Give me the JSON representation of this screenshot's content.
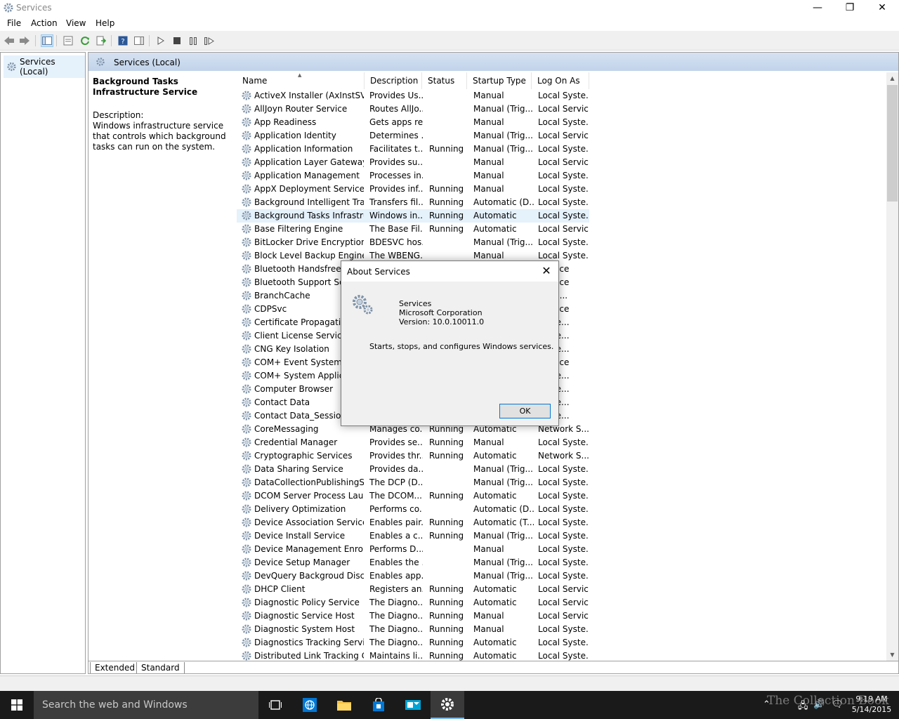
{
  "window": {
    "title": "Services",
    "minimize": "—",
    "maximize": "❐",
    "close": "✕"
  },
  "menu": [
    "File",
    "Action",
    "View",
    "Help"
  ],
  "tree": {
    "root_label": "Services (Local)"
  },
  "main": {
    "header_title": "Services (Local)",
    "selected_service_title": "Background Tasks Infrastructure Service",
    "description_label": "Description:",
    "description_text": "Windows infrastructure service that controls which background tasks can run on the system."
  },
  "table": {
    "columns": [
      "Name",
      "Description",
      "Status",
      "Startup Type",
      "Log On As"
    ],
    "sort_indicator": "▲",
    "selected_index": 9,
    "rows": [
      [
        "ActiveX Installer (AxInstSV)",
        "Provides Us...",
        "",
        "Manual",
        "Local Syste..."
      ],
      [
        "AllJoyn Router Service",
        "Routes AllJo...",
        "",
        "Manual (Trig...",
        "Local Service"
      ],
      [
        "App Readiness",
        "Gets apps re...",
        "",
        "Manual",
        "Local Syste..."
      ],
      [
        "Application Identity",
        "Determines ...",
        "",
        "Manual (Trig...",
        "Local Service"
      ],
      [
        "Application Information",
        "Facilitates t...",
        "Running",
        "Manual (Trig...",
        "Local Syste..."
      ],
      [
        "Application Layer Gateway ...",
        "Provides su...",
        "",
        "Manual",
        "Local Service"
      ],
      [
        "Application Management",
        "Processes in...",
        "",
        "Manual",
        "Local Syste..."
      ],
      [
        "AppX Deployment Service (...",
        "Provides inf...",
        "Running",
        "Manual",
        "Local Syste..."
      ],
      [
        "Background Intelligent Tran...",
        "Transfers fil...",
        "Running",
        "Automatic (D...",
        "Local Syste..."
      ],
      [
        "Background Tasks Infrastru...",
        "Windows in...",
        "Running",
        "Automatic",
        "Local Syste..."
      ],
      [
        "Base Filtering Engine",
        "The Base Fil...",
        "Running",
        "Automatic",
        "Local Service"
      ],
      [
        "BitLocker Drive Encryption ...",
        "BDESVC hos...",
        "",
        "Manual (Trig...",
        "Local Syste..."
      ],
      [
        "Block Level Backup Engine ...",
        "The WBENG...",
        "",
        "Manual",
        "Local Syste..."
      ],
      [
        "Bluetooth Handsfree Se",
        "",
        "",
        "",
        "Service"
      ],
      [
        "Bluetooth Support Servi",
        "",
        "",
        "",
        "Service"
      ],
      [
        "BranchCache",
        "",
        "",
        "",
        "ork S..."
      ],
      [
        "CDPSvc",
        "",
        "",
        "",
        "Service"
      ],
      [
        "Certificate Propagation",
        "",
        "",
        "",
        "Syste..."
      ],
      [
        "Client License Service (C",
        "",
        "",
        "",
        "Syste..."
      ],
      [
        "CNG Key Isolation",
        "",
        "",
        "",
        "Syste..."
      ],
      [
        "COM+ Event System",
        "",
        "",
        "",
        "Service"
      ],
      [
        "COM+ System Applicat",
        "",
        "",
        "",
        "Syste..."
      ],
      [
        "Computer Browser",
        "",
        "",
        "",
        "Syste..."
      ],
      [
        "Contact Data",
        "",
        "",
        "",
        "Syste..."
      ],
      [
        "Contact Data_Session1",
        "",
        "",
        "",
        "Syste..."
      ],
      [
        "CoreMessaging",
        "Manages co...",
        "Running",
        "Automatic",
        "Network S..."
      ],
      [
        "Credential Manager",
        "Provides se...",
        "Running",
        "Manual",
        "Local Syste..."
      ],
      [
        "Cryptographic Services",
        "Provides thr...",
        "Running",
        "Automatic",
        "Network S..."
      ],
      [
        "Data Sharing Service",
        "Provides da...",
        "",
        "Manual (Trig...",
        "Local Syste..."
      ],
      [
        "DataCollectionPublishingSe...",
        "The DCP (D...",
        "",
        "Manual (Trig...",
        "Local Syste..."
      ],
      [
        "DCOM Server Process Laun...",
        "The DCOM...",
        "Running",
        "Automatic",
        "Local Syste..."
      ],
      [
        "Delivery Optimization",
        "Performs co...",
        "",
        "Automatic (D...",
        "Local Syste..."
      ],
      [
        "Device Association Service",
        "Enables pair...",
        "Running",
        "Automatic (T...",
        "Local Syste..."
      ],
      [
        "Device Install Service",
        "Enables a c...",
        "Running",
        "Manual (Trig...",
        "Local Syste..."
      ],
      [
        "Device Management Enroll...",
        "Performs D...",
        "",
        "Manual",
        "Local Syste..."
      ],
      [
        "Device Setup Manager",
        "Enables the ...",
        "",
        "Manual (Trig...",
        "Local Syste..."
      ],
      [
        "DevQuery Backgroud Disco...",
        "Enables app...",
        "",
        "Manual (Trig...",
        "Local Syste..."
      ],
      [
        "DHCP Client",
        "Registers an...",
        "Running",
        "Automatic",
        "Local Service"
      ],
      [
        "Diagnostic Policy Service",
        "The Diagno...",
        "Running",
        "Automatic",
        "Local Service"
      ],
      [
        "Diagnostic Service Host",
        "The Diagno...",
        "Running",
        "Manual",
        "Local Service"
      ],
      [
        "Diagnostic System Host",
        "The Diagno...",
        "Running",
        "Manual",
        "Local Syste..."
      ],
      [
        "Diagnostics Tracking Service",
        "The Diagno...",
        "Running",
        "Automatic",
        "Local Syste..."
      ],
      [
        "Distributed Link Tracking Cl...",
        "Maintains li...",
        "Running",
        "Automatic",
        "Local Syste..."
      ]
    ]
  },
  "bottom_tabs": [
    "Extended",
    "Standard"
  ],
  "dialog": {
    "title": "About Services",
    "product": "Services",
    "company": "Microsoft Corporation",
    "version": "Version: 10.0.10011.0",
    "description": "Starts, stops, and configures Windows services.",
    "ok_label": "OK",
    "close": "✕"
  },
  "taskbar": {
    "search_placeholder": "Search the web and Windows",
    "time": "9:19 AM",
    "date": "5/14/2015"
  },
  "watermark": "The Collection Book",
  "colors": {
    "selection": "#e5f1fb",
    "header_gradient": "#c1d3ea",
    "taskbar": "#1a1a1a",
    "accent": "#0078d7"
  }
}
